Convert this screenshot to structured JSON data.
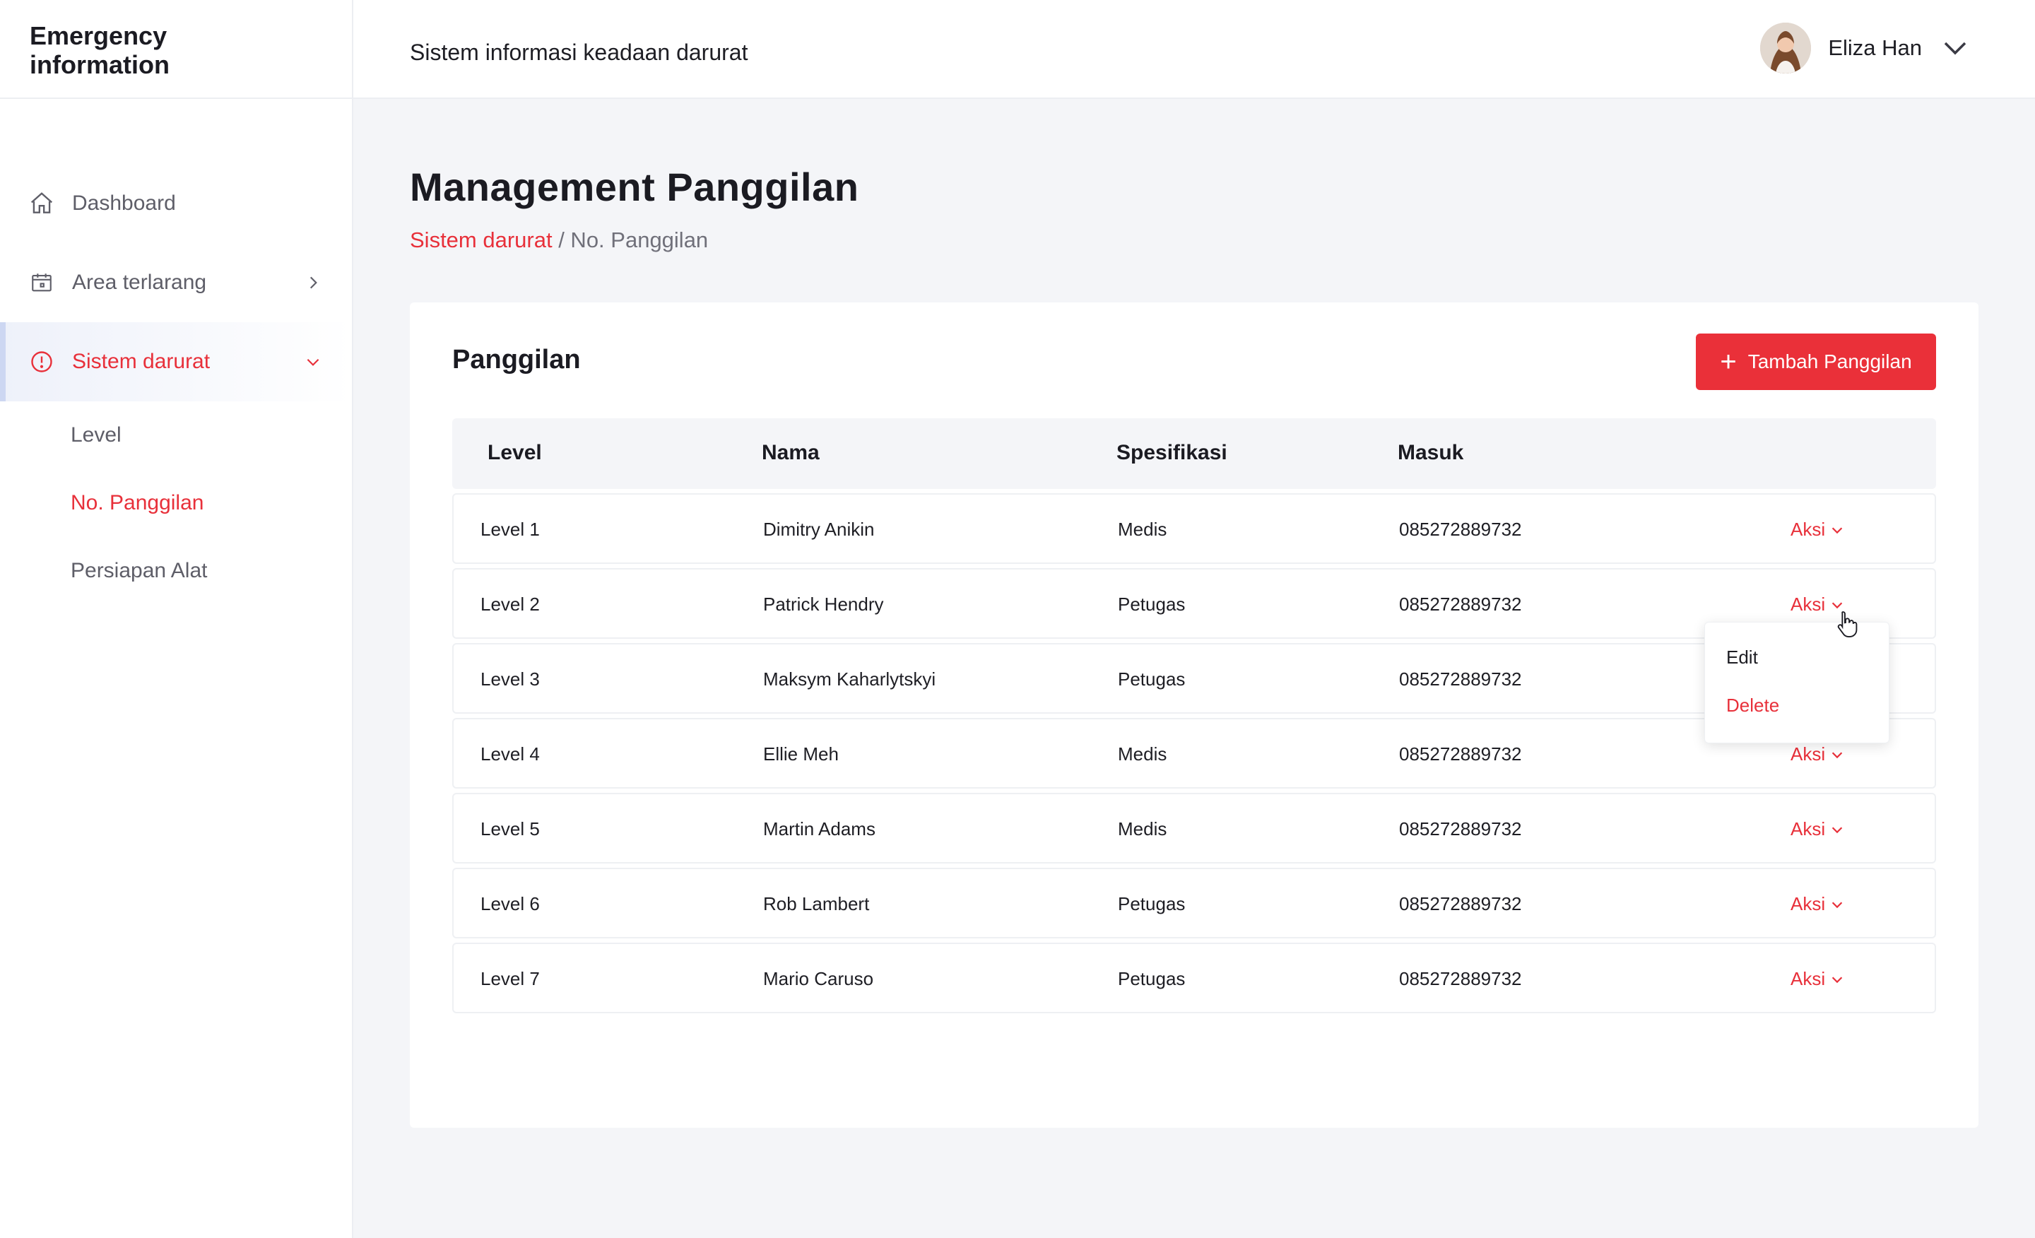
{
  "brand": {
    "title": "Emergency information"
  },
  "topbar": {
    "title": "Sistem informasi keadaan darurat"
  },
  "user": {
    "name": "Eliza Han"
  },
  "sidebar": {
    "items": [
      {
        "label": "Dashboard",
        "icon": "home-icon"
      },
      {
        "label": "Area terlarang",
        "icon": "calendar-icon"
      },
      {
        "label": "Sistem darurat",
        "icon": "info-icon",
        "active": true
      }
    ],
    "sub_items": [
      {
        "label": "Level"
      },
      {
        "label": "No. Panggilan",
        "active": true
      },
      {
        "label": "Persiapan Alat"
      }
    ]
  },
  "page": {
    "title": "Management Panggilan",
    "breadcrumb_link": "Sistem darurat",
    "breadcrumb_current": "/ No. Panggilan"
  },
  "card": {
    "title": "Panggilan",
    "add_button": "Tambah Panggilan"
  },
  "table": {
    "columns": [
      "Level",
      "Nama",
      "Spesifikasi",
      "Masuk"
    ],
    "rows": [
      {
        "level": "Level 1",
        "nama": "Dimitry Anikin",
        "spek": "Medis",
        "masuk": "085272889732",
        "aksi": "Aksi"
      },
      {
        "level": "Level 2",
        "nama": "Patrick Hendry",
        "spek": "Petugas",
        "masuk": "085272889732",
        "aksi": "Aksi"
      },
      {
        "level": "Level 3",
        "nama": "Maksym Kaharlytskyi",
        "spek": "Petugas",
        "masuk": "085272889732",
        "aksi": ""
      },
      {
        "level": "Level 4",
        "nama": "Ellie Meh",
        "spek": "Medis",
        "masuk": "085272889732",
        "aksi": "Aksi"
      },
      {
        "level": "Level 5",
        "nama": "Martin Adams",
        "spek": "Medis",
        "masuk": "085272889732",
        "aksi": "Aksi"
      },
      {
        "level": "Level 6",
        "nama": "Rob Lambert",
        "spek": "Petugas",
        "masuk": "085272889732",
        "aksi": "Aksi"
      },
      {
        "level": "Level 7",
        "nama": "Mario Caruso",
        "spek": "Petugas",
        "masuk": "085272889732",
        "aksi": "Aksi"
      }
    ]
  },
  "dropdown": {
    "edit": "Edit",
    "delete": "Delete"
  },
  "colors": {
    "accent": "#e8303a",
    "background": "#f4f5f8",
    "text": "#1e1e24"
  }
}
